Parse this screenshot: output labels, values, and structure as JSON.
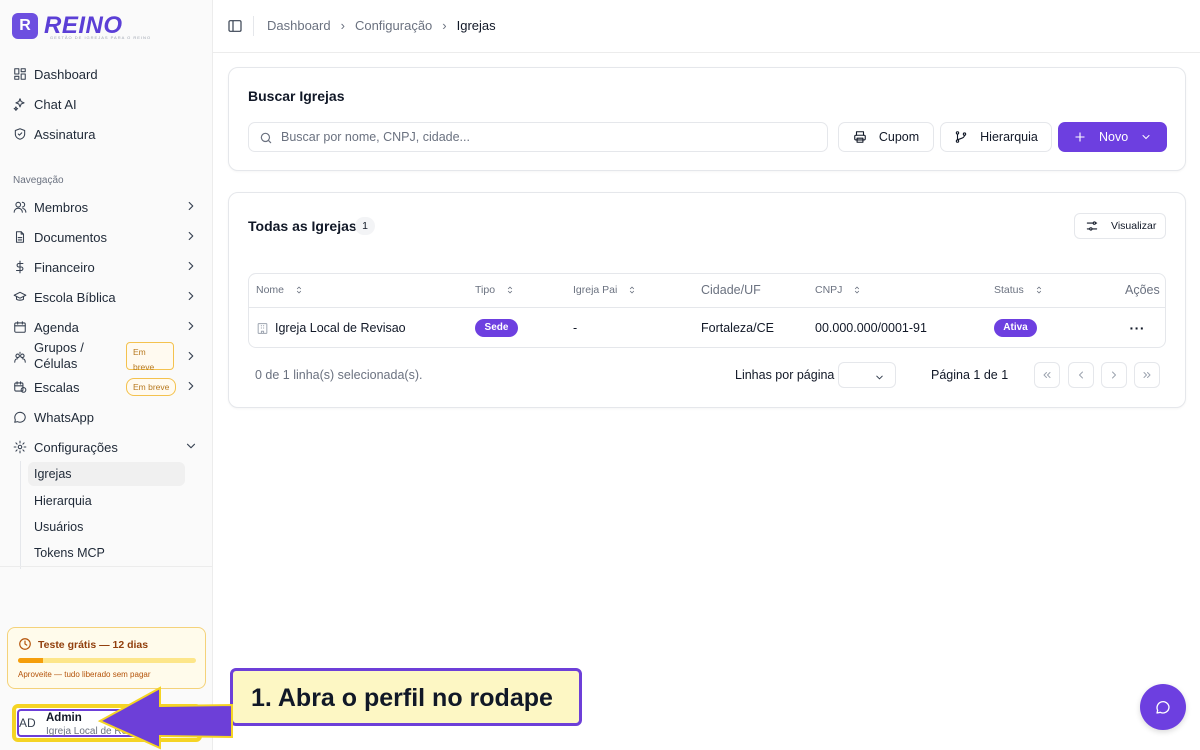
{
  "brand": {
    "name": "REINO",
    "tagline": "GESTÃO DE IGREJAS PARA O REINO",
    "mark": "R"
  },
  "sidebar": {
    "top_items": [
      {
        "label": "Dashboard",
        "icon": "grid-icon"
      },
      {
        "label": "Chat AI",
        "icon": "sparkles-icon"
      },
      {
        "label": "Assinatura",
        "icon": "shield-check-icon"
      }
    ],
    "section_label": "Navegação",
    "nav_items": [
      {
        "label": "Membros",
        "icon": "users-icon",
        "has_chevron": true
      },
      {
        "label": "Documentos",
        "icon": "file-text-icon",
        "has_chevron": true
      },
      {
        "label": "Financeiro",
        "icon": "dollar-icon",
        "has_chevron": true
      },
      {
        "label": "Escola Bíblica",
        "icon": "graduation-cap-icon",
        "has_chevron": true
      },
      {
        "label": "Agenda",
        "icon": "calendar-icon",
        "has_chevron": true
      },
      {
        "label": "Grupos / Células",
        "icon": "groups-icon",
        "has_chevron": true,
        "badge": "Em breve"
      },
      {
        "label": "Escalas",
        "icon": "calendar-clock-icon",
        "has_chevron": true,
        "badge": "Em breve"
      },
      {
        "label": "WhatsApp",
        "icon": "message-circle-icon",
        "has_chevron": false
      },
      {
        "label": "Configurações",
        "icon": "settings-icon",
        "has_chevron": true,
        "expanded": true
      }
    ],
    "sub_items": [
      {
        "label": "Igrejas",
        "active": true
      },
      {
        "label": "Hierarquia"
      },
      {
        "label": "Usuários"
      },
      {
        "label": "Tokens MCP"
      }
    ],
    "trial": {
      "title": "Teste grátis — 12 dias",
      "note": "Aproveite — tudo liberado sem pagar",
      "progress": 0.14
    },
    "profile": {
      "initials": "AD",
      "name": "Admin",
      "org": "Igreja Local de Revisao"
    }
  },
  "topbar": {
    "breadcrumbs": [
      "Dashboard",
      "Configuração",
      "Igrejas"
    ]
  },
  "search_card": {
    "title": "Buscar Igrejas",
    "search_placeholder": "Buscar por nome, CNPJ, cidade...",
    "btn_cupom": "Cupom",
    "btn_hierarquia": "Hierarquia",
    "btn_novo": "Novo"
  },
  "table_card": {
    "title": "Todas as Igrejas",
    "count": "1",
    "btn_visualizar": "Visualizar",
    "columns": [
      "Nome",
      "Tipo",
      "Igreja Pai",
      "Cidade/UF",
      "CNPJ",
      "Status",
      "Ações"
    ],
    "rows": [
      {
        "nome": "Igreja Local de Revisao",
        "tipo": "Sede",
        "igreja_pai": "-",
        "cidade": "Fortaleza/CE",
        "cnpj": "00.000.000/0001-91",
        "status": "Ativa"
      }
    ],
    "selection_info": "0 de 1 linha(s) selecionada(s).",
    "rows_per_page_label": "Linhas por página",
    "page_info": "Página 1 de 1"
  },
  "annotation": {
    "text": "1. Abra o perfil no rodape"
  },
  "colors": {
    "accent": "#6d3fe0",
    "highlight": "#f5d424",
    "callout_bg": "#fdf7c4"
  }
}
